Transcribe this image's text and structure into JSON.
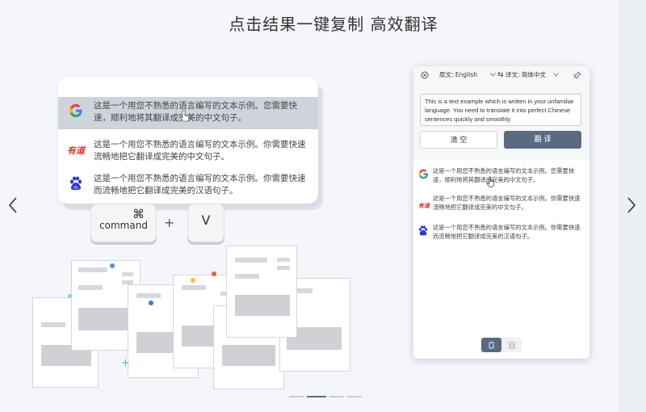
{
  "heading": "点击结果一键复制 高效翻译",
  "nav": {
    "prev_icon": "chevron-left-icon",
    "next_icon": "chevron-right-icon"
  },
  "demo_card": {
    "rows": [
      {
        "engine": "google",
        "text": "这是一个用您不熟悉的语言编写的文本示例。您需要快速，顺利地将其翻译成完美的中文句子。"
      },
      {
        "engine": "youdao",
        "logo_text": "有道",
        "text": "这是一个用您不熟悉的语言编写的文本示例。你需要快速流畅地把它翻译成完美的中文句子。"
      },
      {
        "engine": "baidu",
        "text": "这是一个用您不熟悉的语言编写的文本示例。你需要快速而流畅地把它翻译成完美的汉语句子。"
      }
    ]
  },
  "shortcut": {
    "cmd_symbol": "⌘",
    "cmd_label": "command",
    "plus": "+",
    "v_key": "V"
  },
  "panel": {
    "source_lang": "原文: English",
    "target_lang": "译文: 简体中文",
    "swap_symbol": "⇆",
    "input_text": "This is a text example which is written in your unfamiliar language. You need to translate it into perfect Chinese sentences quickly and smoothly.",
    "clear_label": "清 空",
    "translate_label": "翻 译",
    "results": [
      {
        "engine": "google",
        "text": "这是一个用您不熟悉的语言编写的文本示例。您需要快速，顺利地将其翻译成完美的中文句子。"
      },
      {
        "engine": "youdao",
        "logo_text": "有道",
        "text": "这是一个用您不熟悉的语言编写的文本示例。你需要快速流畅地把它翻译成完美的中文句子。"
      },
      {
        "engine": "baidu",
        "text": "这是一个用您不熟悉的语言编写的文本示例。你需要快速而流畅地把它翻译成完美的汉语句子。"
      }
    ]
  },
  "colors": {
    "translate_btn": "#5a6b80",
    "highlight": "#cfd4dc",
    "youdao_red": "#e5322c",
    "baidu_blue": "#2932e1"
  },
  "pager": {
    "count": 4,
    "active": 1
  }
}
